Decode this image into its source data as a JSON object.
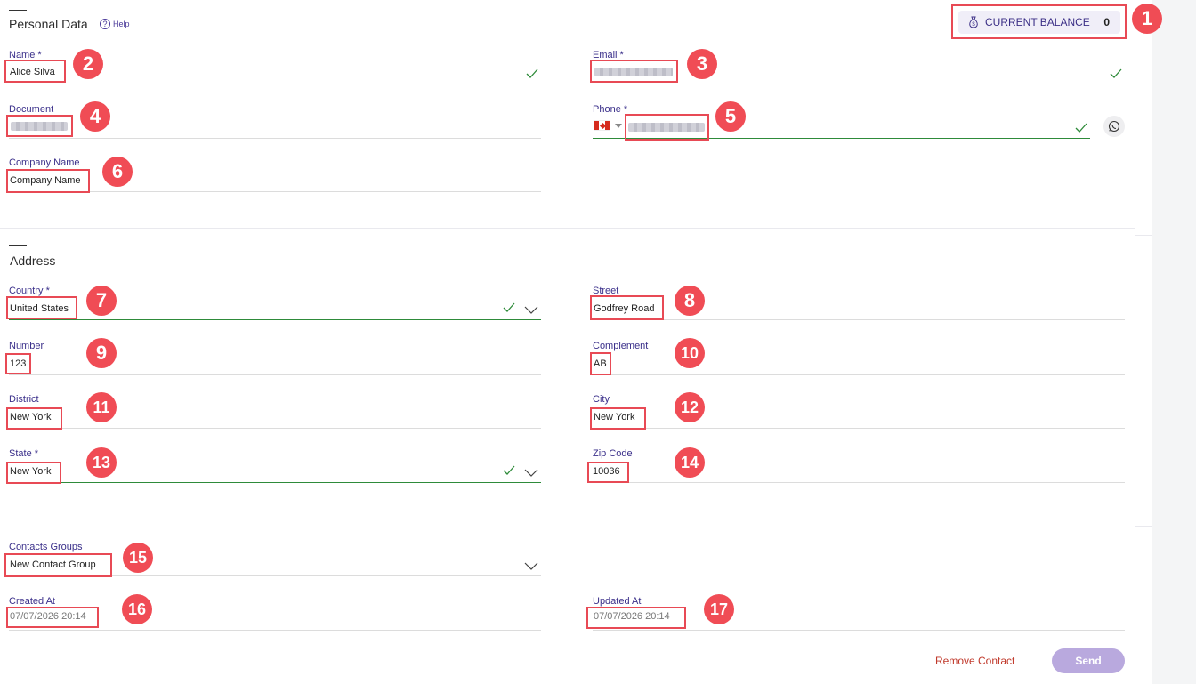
{
  "personal_data": {
    "title": "Personal Data",
    "help_label": "Help",
    "balance_label": "CURRENT BALANCE",
    "balance_value": "0",
    "name_label": "Name *",
    "name_value": "Alice Silva",
    "email_label": "Email *",
    "document_label": "Document",
    "phone_label": "Phone *",
    "phone_country_flag": "canada-flag",
    "company_label": "Company Name",
    "company_value": "Company Name"
  },
  "address": {
    "title": "Address",
    "country_label": "Country *",
    "country_value": "United States",
    "street_label": "Street",
    "street_value": "Godfrey Road",
    "number_label": "Number",
    "number_value": "123",
    "complement_label": "Complement",
    "complement_value": "AB",
    "district_label": "District",
    "district_value": "New York",
    "city_label": "City",
    "city_value": "New York",
    "state_label": "State *",
    "state_value": "New York",
    "zip_label": "Zip Code",
    "zip_value": "10036"
  },
  "meta": {
    "groups_label": "Contacts Groups",
    "groups_value": "New Contact Group",
    "created_label": "Created At",
    "created_value": "07/07/2026 20:14",
    "updated_label": "Updated At",
    "updated_value": "07/07/2026 20:14"
  },
  "actions": {
    "remove_label": "Remove Contact",
    "send_label": "Send"
  },
  "annotations": [
    "1",
    "2",
    "3",
    "4",
    "5",
    "6",
    "7",
    "8",
    "9",
    "10",
    "11",
    "12",
    "13",
    "14",
    "15",
    "16",
    "17"
  ],
  "colors": {
    "accent": "#3a2f8a",
    "valid": "#2e8b3a",
    "highlight": "#e84a55",
    "send_button": "#b9a9de",
    "remove": "#c0392b"
  }
}
